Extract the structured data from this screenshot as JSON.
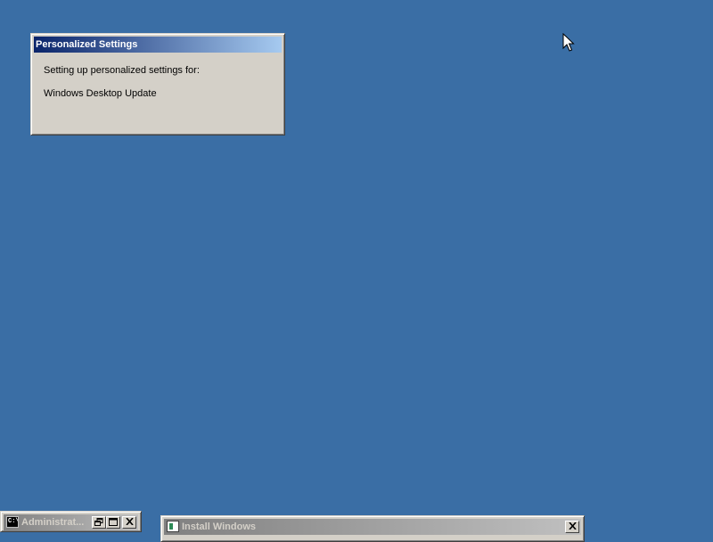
{
  "desktop": {
    "background_color": "#3a6ea5"
  },
  "personalized_settings": {
    "title": "Personalized Settings",
    "line1": "Setting up personalized settings for:",
    "line2": "Windows Desktop Update"
  },
  "cmd_window": {
    "title": "Administrat...",
    "icon": "cmd-icon",
    "icon_text": "C:\\"
  },
  "install_window": {
    "title": "Install Windows",
    "icon": "setup-icon"
  },
  "colors": {
    "active_title_start": "#0a246a",
    "active_title_end": "#a6caf0",
    "inactive_title_start": "#808080",
    "inactive_title_end": "#c0c0c0",
    "window_face": "#d4d0c8"
  }
}
